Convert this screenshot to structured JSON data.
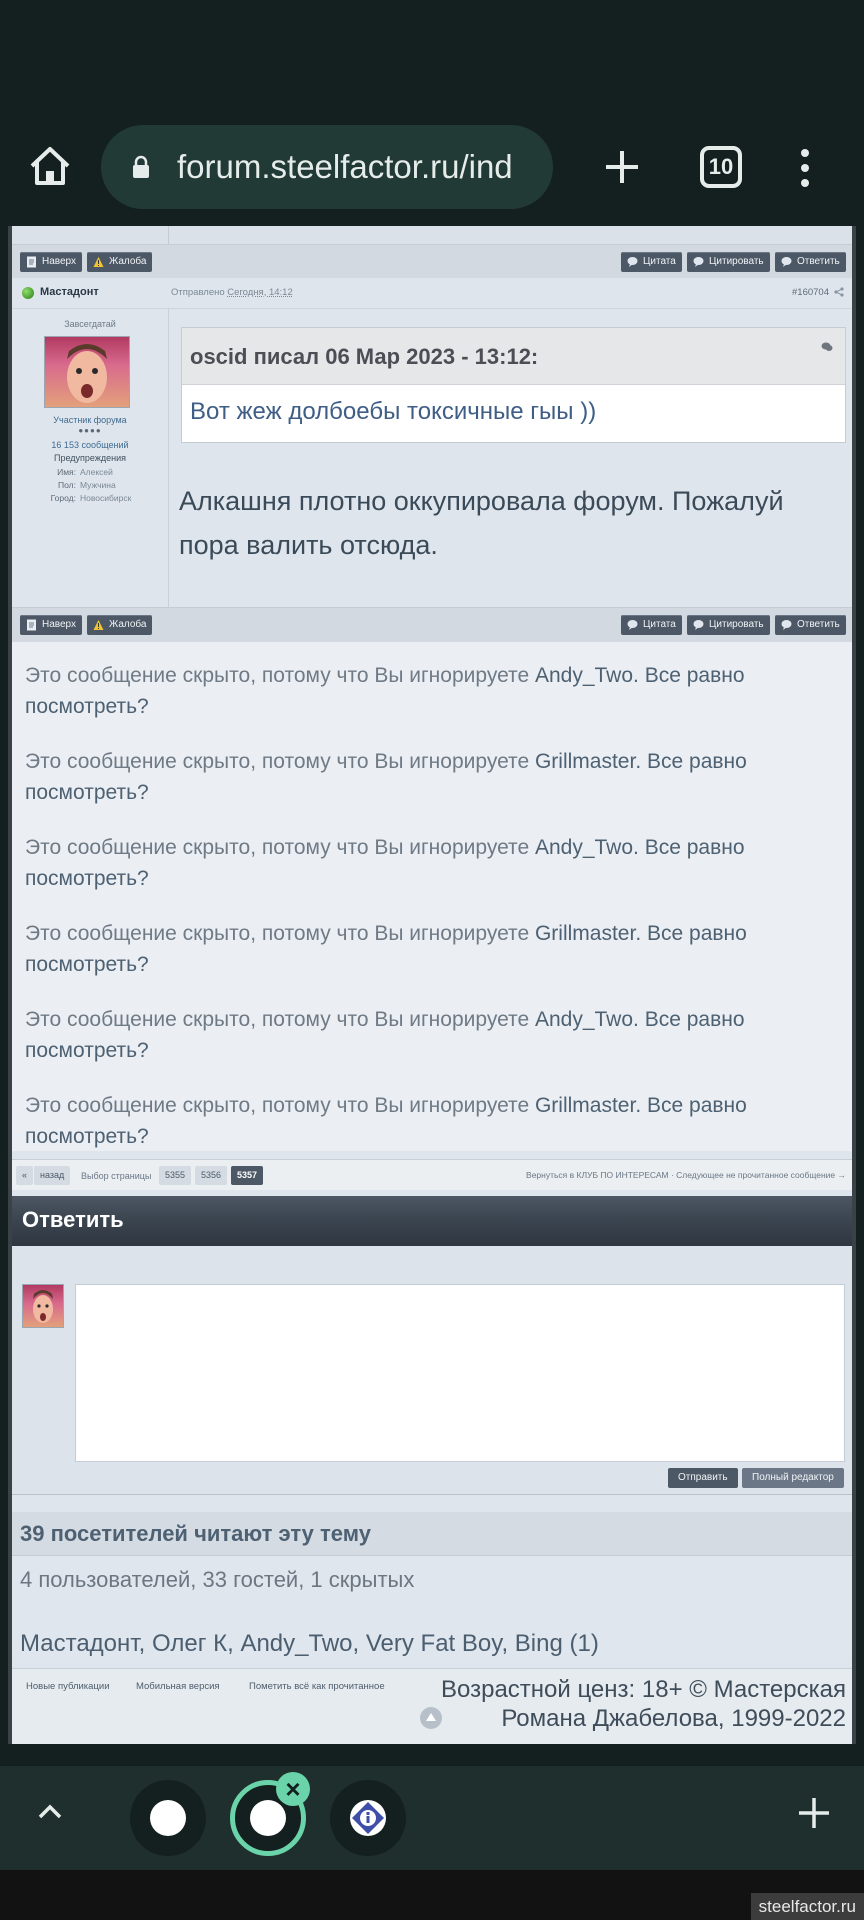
{
  "browser": {
    "url": "forum.steelfactor.ru/ind",
    "tab_count": "10",
    "site_chip": "steelfactor.ru"
  },
  "post_buttons": {
    "top": "Наверх",
    "report": "Жалоба",
    "quote": "Цитата",
    "cite": "Цитировать",
    "reply": "Ответить"
  },
  "post": {
    "author": "Мастадонт",
    "sent_label": "Отправлено",
    "sent_time": "Сегодня, 14:12",
    "number": "#160704",
    "rank": "Завсегдатай",
    "user_title": "Участник форума",
    "pips": "●●●●",
    "post_count": "16 153 сообщений",
    "warnings": "Предупреждения",
    "info": [
      {
        "key": "Имя:",
        "value": "Алексей"
      },
      {
        "key": "Пол:",
        "value": "Мужчина"
      },
      {
        "key": "Город:",
        "value": "Новосибирск"
      }
    ],
    "quote_header": "oscid писал 06 Мар 2023 - 13:12:",
    "quote_text": "Вот жеж долбоебы токсичные гыы ))",
    "text": "Алкашня плотно оккупировала форум. Пожалуй пора валить отсюда."
  },
  "hidden_messages": [
    {
      "prefix": "Это сообщение скрыто, потому что Вы игнорируете ",
      "name": "Andy_Two",
      "suffix": ". Все равно посмотреть?"
    },
    {
      "prefix": "Это сообщение скрыто, потому что Вы игнорируете ",
      "name": "Grillmaster",
      "suffix": ". Все равно посмотреть?"
    },
    {
      "prefix": "Это сообщение скрыто, потому что Вы игнорируете ",
      "name": "Andy_Two",
      "suffix": ". Все равно посмотреть?"
    },
    {
      "prefix": "Это сообщение скрыто, потому что Вы игнорируете ",
      "name": "Grillmaster",
      "suffix": ". Все равно посмотреть?"
    },
    {
      "prefix": "Это сообщение скрыто, потому что Вы игнорируете ",
      "name": "Andy_Two",
      "suffix": ". Все равно посмотреть?"
    },
    {
      "prefix": "Это сообщение скрыто, потому что Вы игнорируете ",
      "name": "Grillmaster",
      "suffix": ". Все равно посмотреть?"
    }
  ],
  "pager": {
    "first": "«",
    "back": "назад",
    "label": "Выбор страницы",
    "pages": [
      "5355",
      "5356",
      "5357"
    ],
    "current": "5357",
    "back_link": "Вернуться в КЛУБ ПО ИНТЕРЕСАМ · Следующее не прочитанное сообщение →"
  },
  "reply": {
    "title": "Ответить",
    "send": "Отправить",
    "full_editor": "Полный редактор"
  },
  "viewers": {
    "title": "39 посетителей читают эту тему",
    "counts": "4 пользователей, 33 гостей, 1 скрытых",
    "names": "Мастадонт, Олег К, Andy_Two, Very Fat Boy, Bing (1)"
  },
  "footer": {
    "links": [
      "Новые публикации",
      "Мобильная версия",
      "Пометить всё как прочитанное"
    ],
    "copyright": "Возрастной ценз: 18+   © Мастерская Романа Джабелова, 1999-2022"
  },
  "colors": {
    "accent": "#6ad3a9",
    "button": "#4d5866",
    "chrome_bg": "#13201f"
  }
}
